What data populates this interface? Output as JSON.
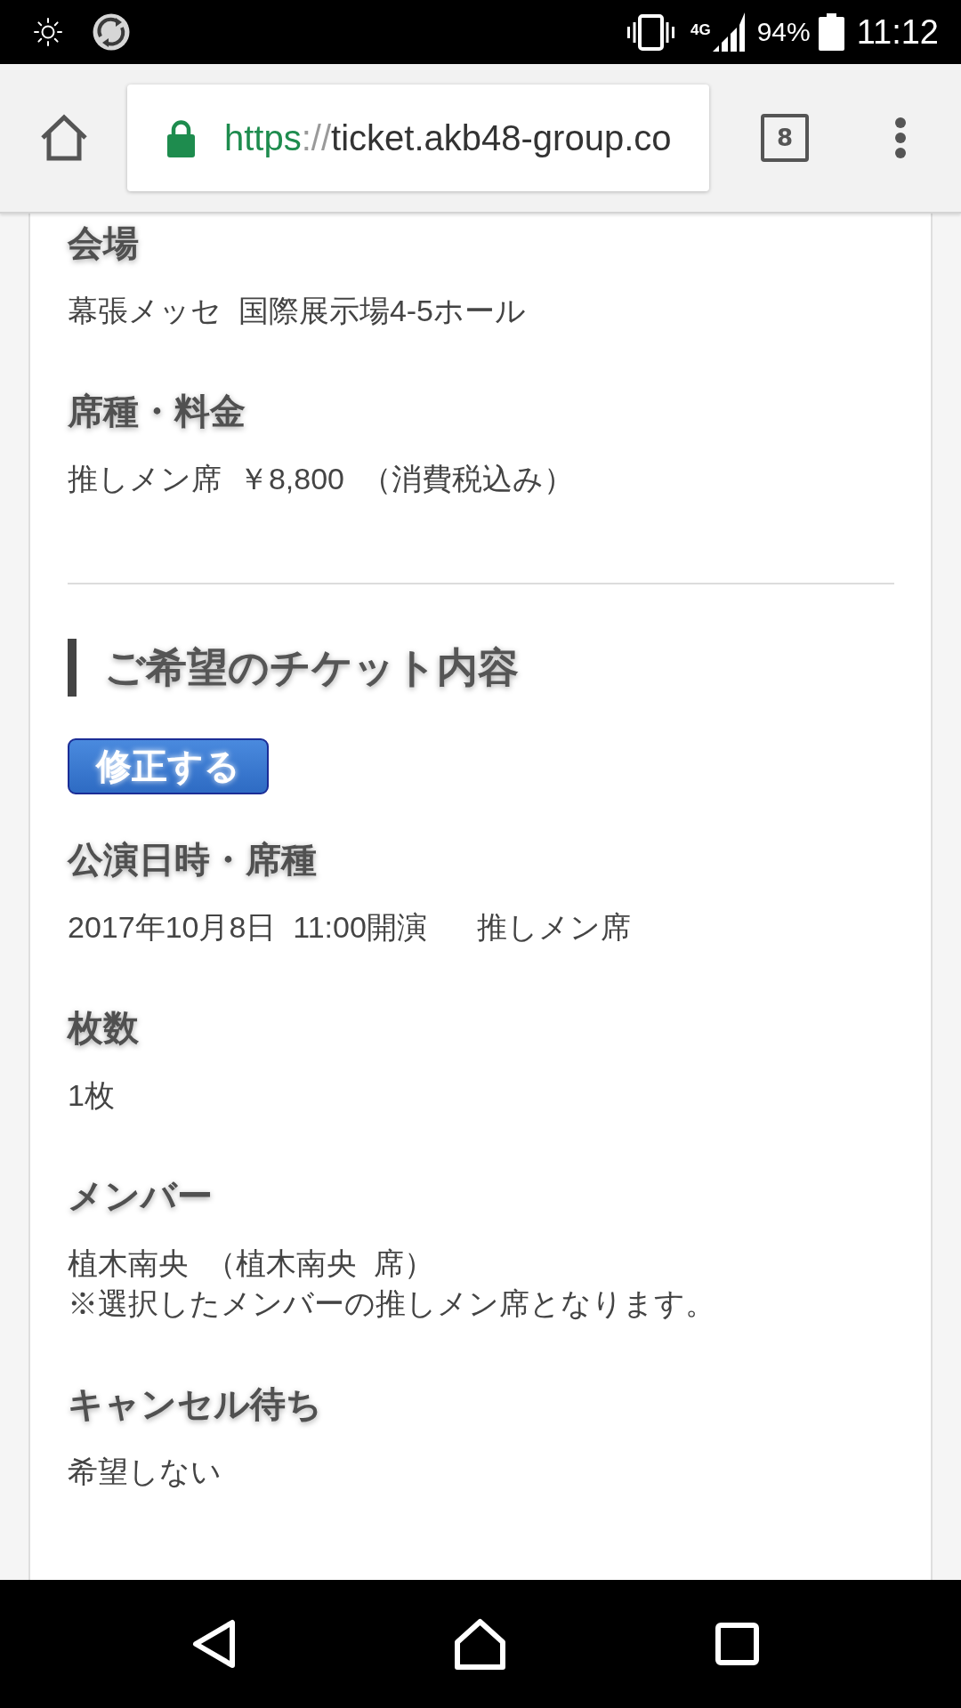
{
  "status_bar": {
    "network": "4G",
    "battery": "94%",
    "time": "11:12"
  },
  "browser_toolbar": {
    "url": {
      "scheme": "https",
      "separator": "://",
      "host": "ticket.akb48-group.co"
    },
    "tab_count": "8"
  },
  "venue_details": [
    {
      "label": "会場",
      "lines": [
        "幕張メッセ  国際展示場4-5ホール"
      ]
    },
    {
      "label": "席種・料金",
      "lines": [
        "推しメン席  ￥8,800  （消費税込み）"
      ]
    }
  ],
  "requested_tickets": {
    "title": "ご希望のチケット内容",
    "edit_button": "修正する",
    "fields": [
      {
        "label": "公演日時・席種",
        "lines": [
          "2017年10月8日  11:00開演      推しメン席"
        ]
      },
      {
        "label": "枚数",
        "lines": [
          "1枚"
        ]
      },
      {
        "label": "メンバー",
        "lines": [
          "植木南央  （植木南央  席）",
          "※選択したメンバーの推しメン席となります。"
        ]
      },
      {
        "label": "キャンセル待ち",
        "lines": [
          "希望しない"
        ]
      }
    ]
  }
}
